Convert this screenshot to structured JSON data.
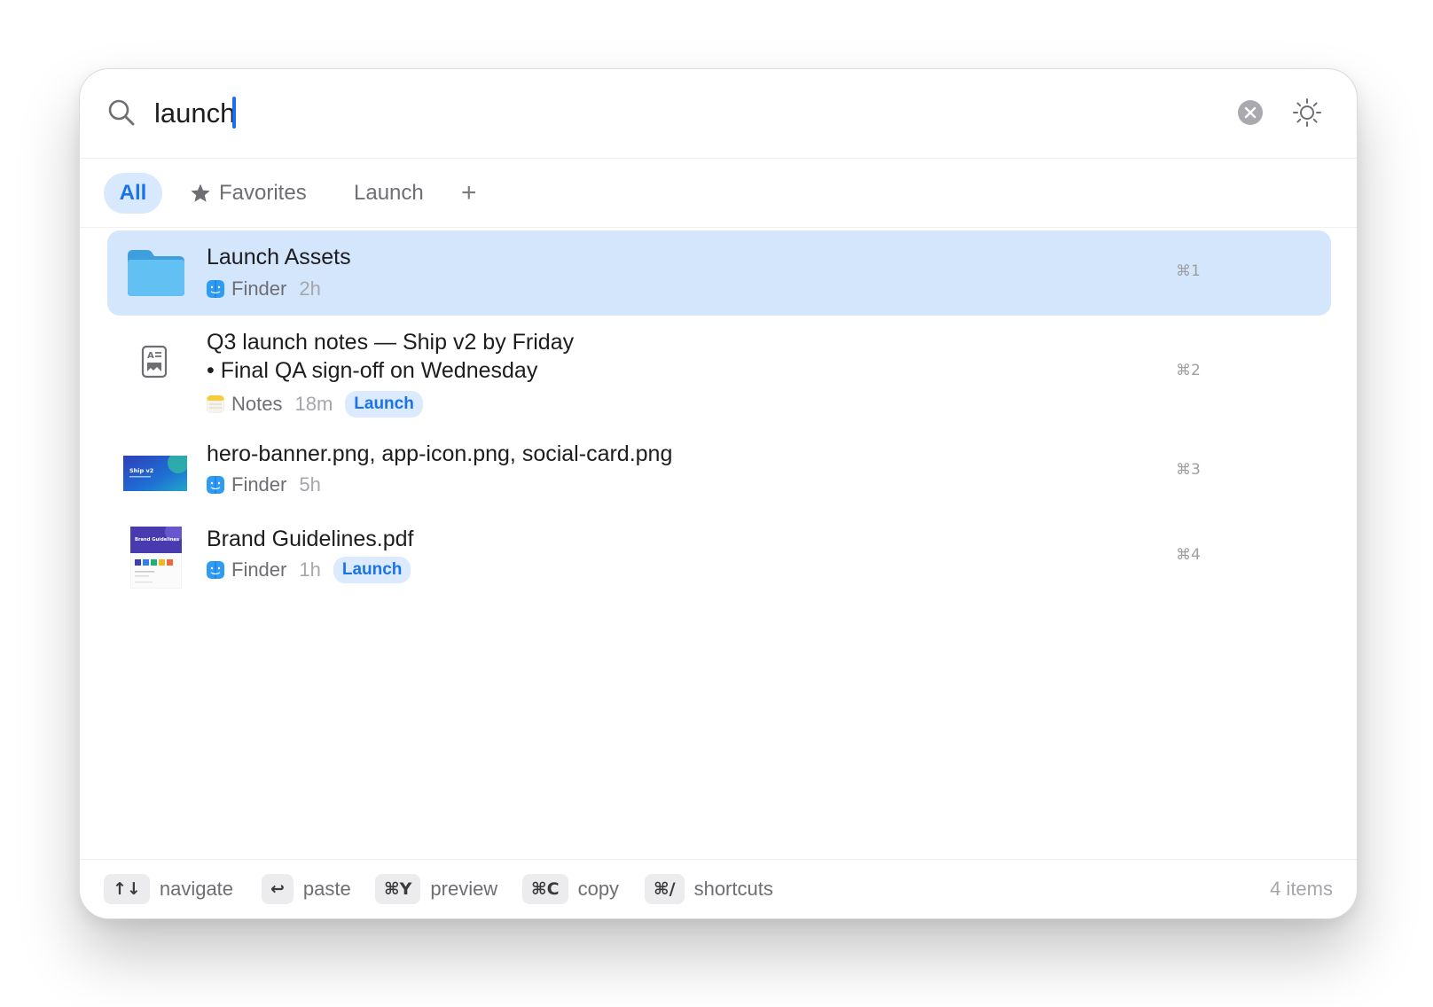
{
  "search": {
    "query": "launch",
    "placeholder": ""
  },
  "tabs": [
    {
      "label": "All",
      "active": true
    },
    {
      "label": "Favorites",
      "icon": "star-icon"
    },
    {
      "label": "Launch"
    },
    {
      "label": "+",
      "icon": "plus-icon"
    }
  ],
  "results": [
    {
      "title": "Launch Assets",
      "app": "Finder",
      "app_icon": "finder-icon",
      "time": "2h",
      "shortcut": "⌘1",
      "thumbnail": "folder-icon",
      "selected": true
    },
    {
      "title_lines": [
        "Q3 launch notes — Ship v2 by Friday",
        "• Final QA sign-off on Wednesday"
      ],
      "app": "Notes",
      "app_icon": "notes-icon",
      "time": "18m",
      "tag": "Launch",
      "shortcut": "⌘2",
      "thumbnail": "text-document-icon"
    },
    {
      "title": "hero-banner.png, app-icon.png, social-card.png",
      "app": "Finder",
      "app_icon": "finder-icon",
      "time": "5h",
      "shortcut": "⌘3",
      "thumbnail": "image-thumbnail",
      "thumbnail_text": "Ship v2"
    },
    {
      "title": "Brand Guidelines.pdf",
      "app": "Finder",
      "app_icon": "finder-icon",
      "time": "1h",
      "tag": "Launch",
      "shortcut": "⌘4",
      "thumbnail": "pdf-thumbnail",
      "thumbnail_text": "Brand Guidelines"
    }
  ],
  "footer": {
    "hints": [
      {
        "key": "↑↓",
        "label": "navigate"
      },
      {
        "key": "↩",
        "label": "paste"
      },
      {
        "key": "⌘Y",
        "label": "preview"
      },
      {
        "key": "⌘C",
        "label": "copy"
      },
      {
        "key": "⌘/",
        "label": "shortcuts"
      }
    ],
    "count": "4 items"
  },
  "colors": {
    "accent": "#1a73e8",
    "selection": "#d3e6fc",
    "tag_background": "#dbeafe",
    "folder": "#5cb8f0"
  }
}
